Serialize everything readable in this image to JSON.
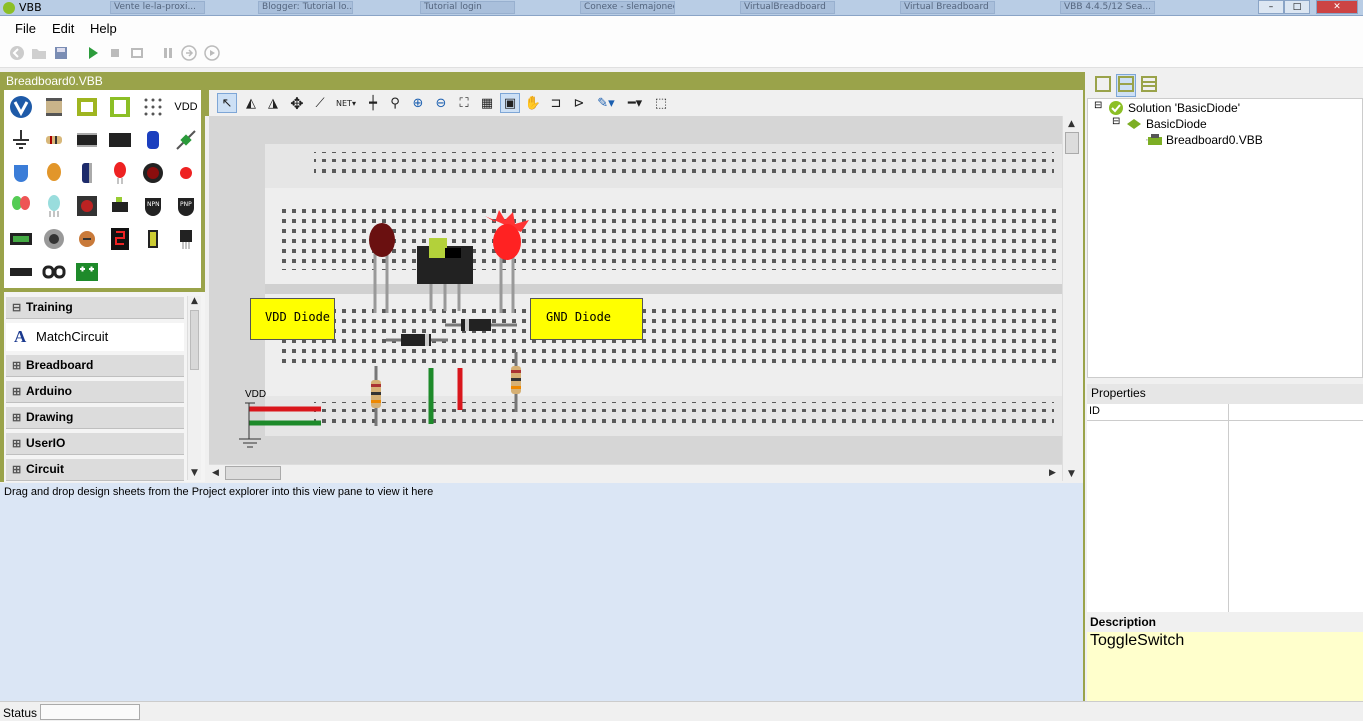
{
  "window": {
    "title": "VBB",
    "controls": {
      "minimize": "–",
      "maximize": "□",
      "close": "✕"
    }
  },
  "taskbar_ghosts": [
    "Vente le-la-proxi...",
    "Blogger: Tutorial lo...",
    "Tutorial login",
    "Conexe - slemajonee...",
    "VirtualBreadboard",
    "Virtual Breadboard",
    "VBB 4.4.5/12 Sea..."
  ],
  "menu": {
    "file": "File",
    "edit": "Edit",
    "help": "Help"
  },
  "toolbar": {
    "icons": [
      "back-icon",
      "open-folder-icon",
      "save-icon",
      "run-icon",
      "stop-icon",
      "step-icon",
      "pause-icon",
      "forward-icon",
      "play-next-icon"
    ]
  },
  "document_tab": {
    "label": "Breadboard0.VBB"
  },
  "palette": {
    "items": [
      "vbb-logo-icon",
      "chip-icon",
      "board-icon",
      "breadboard-green-icon",
      "dot-grid-icon",
      "vdd-icon",
      "ground-icon",
      "resistor-icon",
      "ic-icon",
      "ic-large-icon",
      "capacitor-blue-icon",
      "diode-green-icon",
      "piezo-icon",
      "capacitor-orange-icon",
      "electrolytic-icon",
      "led-red-icon",
      "button-big-icon",
      "led-small-icon",
      "led-multicolor-icon",
      "led-rgb-icon",
      "push-button-icon",
      "switch-icon",
      "npn-icon",
      "pnp-icon",
      "module-icon",
      "potentiometer-icon",
      "trimmer-icon",
      "seven-segment-icon",
      "battery-icon",
      "regulator-icon",
      "header-icon",
      "connector-icon",
      "terminal-green-icon"
    ],
    "vdd_label": "VDD"
  },
  "categories": {
    "training": "Training",
    "training_item": "MatchCircuit",
    "breadboard": "Breadboard",
    "arduino": "Arduino",
    "drawing": "Drawing",
    "userio": "UserIO",
    "circuit": "Circuit"
  },
  "design_toolbar": {
    "tools": [
      "pointer-icon",
      "flip-h-icon",
      "flip-v-icon",
      "move-icon",
      "wire-icon",
      "net-icon",
      "junction-icon",
      "magnify-icon",
      "zoom-in-icon",
      "zoom-out-icon",
      "zoom-fit-icon",
      "grid-icon",
      "lock-icon",
      "hand-icon",
      "port-in-icon",
      "port-out-icon",
      "pen-icon",
      "line-style-icon",
      "select-box-icon"
    ],
    "net_label": "NET"
  },
  "canvas": {
    "label_vdd_diode": "VDD Diode",
    "label_gnd_diode": "GND Diode",
    "vdd_label": "VDD"
  },
  "output": {
    "message": "Drag and drop design sheets from the Project explorer into this view pane to view it here"
  },
  "status": {
    "label": "Status"
  },
  "explorer": {
    "solution": "Solution 'BasicDiode'",
    "project": "BasicDiode",
    "file": "Breadboard0.VBB"
  },
  "properties": {
    "header": "Properties",
    "id_label": "ID"
  },
  "description": {
    "header": "Description",
    "text": "ToggleSwitch"
  },
  "colors": {
    "accent": "#9aa34a",
    "label_yellow": "#ffff00",
    "output_bg": "#dbe6f5"
  }
}
